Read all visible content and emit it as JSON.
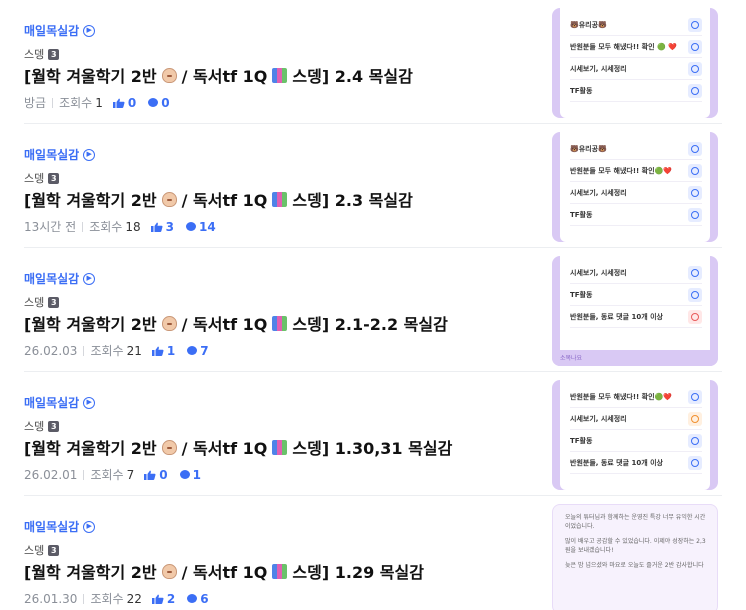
{
  "posts": [
    {
      "board": "매일목실감",
      "author": "스뎅",
      "level": "3",
      "title_pre": "[월학 겨울학기 2반",
      "title_mid": "/ 독서tf 1Q",
      "title_post": "스뎅] 2.4 목실감",
      "date": "방금",
      "views_label": "조회수",
      "views": "1",
      "likes": "0",
      "comments": "0",
      "thumb": {
        "style": "list",
        "rows": [
          {
            "text": "🐻유리공🐻",
            "icon": "blue"
          },
          {
            "text": "반원분들 모두 해냈다!! 확인 🟢 ❤️",
            "icon": "blue"
          },
          {
            "text": "시세보기, 시세정리",
            "icon": "blue"
          },
          {
            "text": "TF활동",
            "icon": "blue"
          }
        ]
      }
    },
    {
      "board": "매일목실감",
      "author": "스뎅",
      "level": "3",
      "title_pre": "[월학 겨울학기 2반",
      "title_mid": "/ 독서tf 1Q",
      "title_post": "스뎅] 2.3 목실감",
      "date": "13시간 전",
      "views_label": "조회수",
      "views": "18",
      "likes": "3",
      "comments": "14",
      "thumb": {
        "style": "list",
        "rows": [
          {
            "text": "🐻유리공🐻",
            "icon": "blue"
          },
          {
            "text": "반원분들 모두 해냈다!! 확인🟢❤️",
            "icon": "blue"
          },
          {
            "text": "시세보기, 시세정리",
            "icon": "blue"
          },
          {
            "text": "TF활동",
            "icon": "blue"
          }
        ]
      }
    },
    {
      "board": "매일목실감",
      "author": "스뎅",
      "level": "3",
      "title_pre": "[월학 겨울학기 2반",
      "title_mid": "/ 독서tf 1Q",
      "title_post": "스뎅] 2.1-2.2 목실감",
      "date": "26.02.03",
      "views_label": "조회수",
      "views": "21",
      "likes": "1",
      "comments": "7",
      "thumb": {
        "style": "list",
        "rows": [
          {
            "text": "시세보기, 시세정리",
            "icon": "blue"
          },
          {
            "text": "TF활동",
            "icon": "blue"
          },
          {
            "text": "반원분들, 동료 댓글 10개 이상",
            "icon": "red"
          }
        ],
        "footer": "소목나요"
      }
    },
    {
      "board": "매일목실감",
      "author": "스뎅",
      "level": "3",
      "title_pre": "[월학 겨울학기 2반",
      "title_mid": "/ 독서tf 1Q",
      "title_post": "스뎅] 1.30,31 목실감",
      "date": "26.02.01",
      "views_label": "조회수",
      "views": "7",
      "likes": "0",
      "comments": "1",
      "thumb": {
        "style": "list",
        "rows": [
          {
            "text": "반원분들 모두 해냈다!! 확인🟢❤️",
            "icon": "blue"
          },
          {
            "text": "시세보기, 시세정리",
            "icon": "orange"
          },
          {
            "text": "TF활동",
            "icon": "blue"
          },
          {
            "text": "반원분들, 동료 댓글 10개 이상",
            "icon": "blue"
          }
        ]
      }
    },
    {
      "board": "매일목실감",
      "author": "스뎅",
      "level": "3",
      "title_pre": "[월학 겨울학기 2반",
      "title_mid": "/ 독서tf 1Q",
      "title_post": "스뎅] 1.29 목실감",
      "date": "26.01.30",
      "views_label": "조회수",
      "views": "22",
      "likes": "2",
      "comments": "6",
      "thumb": {
        "style": "text",
        "paragraphs": [
          "오늘의 튜터님과 함께하는 운영진 특강 너무 유익한 시간이었습니다.",
          "많이 배우고 공감할 수 있었습니다. 이제야 성장하는 2,3원을 보내겠습니다!",
          "늦은 밤 넘으셨와 마요로 오늘도 즐거운 2반 감사합니다"
        ]
      }
    }
  ]
}
